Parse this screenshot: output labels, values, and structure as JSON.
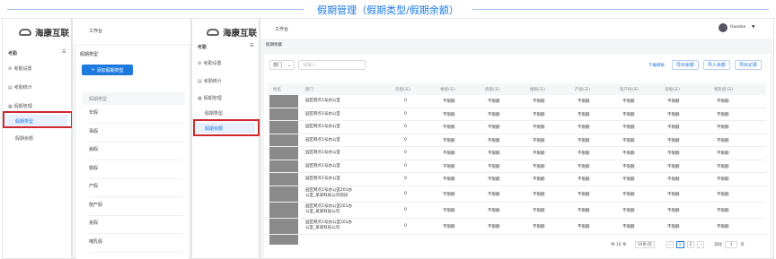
{
  "banner": {
    "title": "假期管理（假期类型/假期余额）"
  },
  "panel1": {
    "logo": "海康互联",
    "module": "考勤",
    "nav": [
      {
        "label": "考勤设置",
        "icon": "gear-icon"
      },
      {
        "label": "考勤统计",
        "icon": "chart-icon"
      },
      {
        "label": "假期管理",
        "icon": "calendar-icon"
      }
    ],
    "sub": [
      "假期类型",
      "假期余额"
    ],
    "workbench": "工作台",
    "page_title": "假期类型",
    "add_button": "添加假期类型",
    "list_header": "假期类型",
    "types": [
      "年假",
      "事假",
      "病假",
      "婚假",
      "产假",
      "陪产假",
      "丧假",
      "哺乳假"
    ]
  },
  "panel2": {
    "logo": "海康互联",
    "workbench": "工作台",
    "user": "Haodon",
    "module": "考勤",
    "nav": [
      {
        "label": "考勤设置",
        "icon": "gear-icon"
      },
      {
        "label": "考勤统计",
        "icon": "chart-icon"
      },
      {
        "label": "假期管理",
        "icon": "calendar-icon"
      }
    ],
    "sub": [
      "假期类型",
      "假期余额"
    ],
    "page_title": "假期余额",
    "filter_select": "部门",
    "filter_placeholder": "请输入",
    "download_link": "下载模板",
    "buttons": [
      "导出余额",
      "导入余额",
      "导出记录"
    ],
    "columns": [
      "姓名",
      "部门",
      "年假(天)",
      "事假(天)",
      "病假(天)",
      "婚假(天)",
      "产假(天)",
      "陪产假(天)",
      "丧假(天)",
      "哺乳假(天)"
    ],
    "rows": [
      {
        "dept": [
          "园区网点1号办公室"
        ],
        "annual": "0",
        "rest": "不限额"
      },
      {
        "dept": [
          "园区网点1号办公室"
        ],
        "annual": "0",
        "rest": "不限额"
      },
      {
        "dept": [
          "园区网点1号办公室"
        ],
        "annual": "0",
        "rest": "不限额"
      },
      {
        "dept": [
          "园区网点1号办公室"
        ],
        "annual": "0",
        "rest": "不限额"
      },
      {
        "dept": [
          "园区网点1号办公室"
        ],
        "annual": "0",
        "rest": "不限额"
      },
      {
        "dept": [
          "园区网点1号办公室"
        ],
        "annual": "0",
        "rest": "不限额"
      },
      {
        "dept": [
          "园区网点1号办公室"
        ],
        "annual": "0",
        "rest": "不限额"
      },
      {
        "dept": [
          "园区网点1号办公室201办",
          "公室_某某科技公司测试"
        ],
        "annual": "0",
        "rest": "不限额"
      },
      {
        "dept": [
          "园区网点1号办公室201办",
          "公室_某某科技公司"
        ],
        "annual": "0",
        "rest": "不限额"
      },
      {
        "dept": [
          "园区网点1号办公室201办",
          "公室_某某科技公司"
        ],
        "annual": "0",
        "rest": "不限额"
      }
    ],
    "pagination": {
      "total": "共 16 条",
      "page_size": "10条/页",
      "pages": [
        "1",
        "2"
      ],
      "current": "1",
      "goto_label": "前往",
      "goto_value": "1",
      "goto_suffix": "页"
    }
  },
  "colors": {
    "accent": "#1f7ae0",
    "highlight": "#d0282e"
  }
}
